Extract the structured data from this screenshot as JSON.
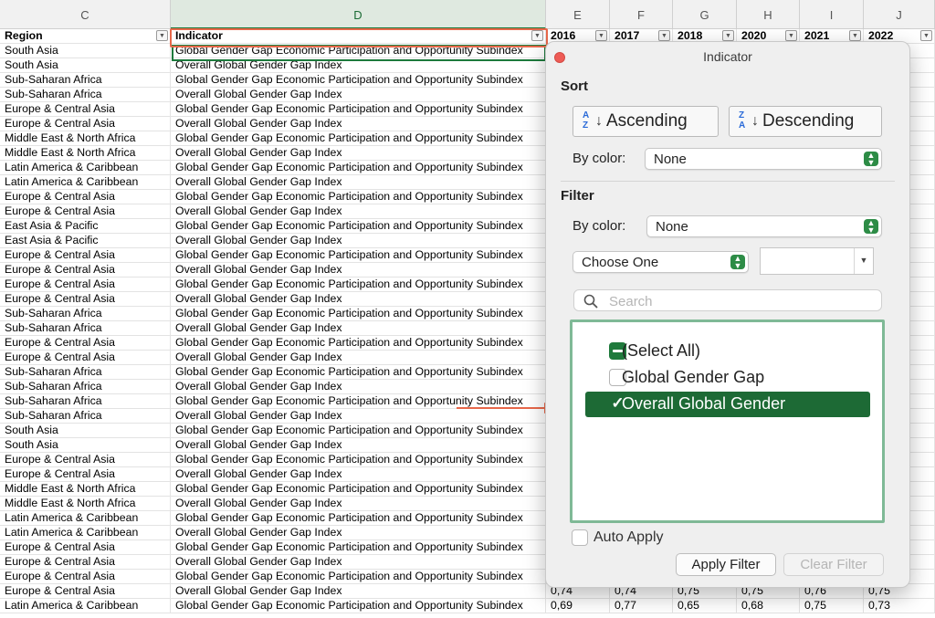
{
  "columns": [
    {
      "letter": "C",
      "header": "Region"
    },
    {
      "letter": "D",
      "header": "Indicator"
    },
    {
      "letter": "E",
      "header": "2016"
    },
    {
      "letter": "F",
      "header": "2017"
    },
    {
      "letter": "G",
      "header": "2018"
    },
    {
      "letter": "H",
      "header": "2020"
    },
    {
      "letter": "I",
      "header": "2021"
    },
    {
      "letter": "J",
      "header": "2022"
    }
  ],
  "rows": [
    [
      "South Asia",
      "Global Gender Gap Economic Participation and Opportunity Subindex"
    ],
    [
      "South Asia",
      "Overall Global Gender Gap Index"
    ],
    [
      "Sub-Saharan Africa",
      "Global Gender Gap Economic Participation and Opportunity Subindex"
    ],
    [
      "Sub-Saharan Africa",
      "Overall Global Gender Gap Index"
    ],
    [
      "Europe & Central Asia",
      "Global Gender Gap Economic Participation and Opportunity Subindex"
    ],
    [
      "Europe & Central Asia",
      "Overall Global Gender Gap Index"
    ],
    [
      "Middle East & North Africa",
      "Global Gender Gap Economic Participation and Opportunity Subindex"
    ],
    [
      "Middle East & North Africa",
      "Overall Global Gender Gap Index"
    ],
    [
      "Latin America & Caribbean",
      "Global Gender Gap Economic Participation and Opportunity Subindex"
    ],
    [
      "Latin America & Caribbean",
      "Overall Global Gender Gap Index"
    ],
    [
      "Europe & Central Asia",
      "Global Gender Gap Economic Participation and Opportunity Subindex"
    ],
    [
      "Europe & Central Asia",
      "Overall Global Gender Gap Index"
    ],
    [
      "East Asia & Pacific",
      "Global Gender Gap Economic Participation and Opportunity Subindex"
    ],
    [
      "East Asia & Pacific",
      "Overall Global Gender Gap Index"
    ],
    [
      "Europe & Central Asia",
      "Global Gender Gap Economic Participation and Opportunity Subindex"
    ],
    [
      "Europe & Central Asia",
      "Overall Global Gender Gap Index"
    ],
    [
      "Europe & Central Asia",
      "Global Gender Gap Economic Participation and Opportunity Subindex"
    ],
    [
      "Europe & Central Asia",
      "Overall Global Gender Gap Index"
    ],
    [
      "Sub-Saharan Africa",
      "Global Gender Gap Economic Participation and Opportunity Subindex"
    ],
    [
      "Sub-Saharan Africa",
      "Overall Global Gender Gap Index"
    ],
    [
      "Europe & Central Asia",
      "Global Gender Gap Economic Participation and Opportunity Subindex"
    ],
    [
      "Europe & Central Asia",
      "Overall Global Gender Gap Index"
    ],
    [
      "Sub-Saharan Africa",
      "Global Gender Gap Economic Participation and Opportunity Subindex"
    ],
    [
      "Sub-Saharan Africa",
      "Overall Global Gender Gap Index"
    ],
    [
      "Sub-Saharan Africa",
      "Global Gender Gap Economic Participation and Opportunity Subindex"
    ],
    [
      "Sub-Saharan Africa",
      "Overall Global Gender Gap Index"
    ],
    [
      "South Asia",
      "Global Gender Gap Economic Participation and Opportunity Subindex"
    ],
    [
      "South Asia",
      "Overall Global Gender Gap Index"
    ],
    [
      "Europe & Central Asia",
      "Global Gender Gap Economic Participation and Opportunity Subindex"
    ],
    [
      "Europe & Central Asia",
      "Overall Global Gender Gap Index"
    ],
    [
      "Middle East & North Africa",
      "Global Gender Gap Economic Participation and Opportunity Subindex"
    ],
    [
      "Middle East & North Africa",
      "Overall Global Gender Gap Index"
    ],
    [
      "Latin America & Caribbean",
      "Global Gender Gap Economic Participation and Opportunity Subindex"
    ],
    [
      "Latin America & Caribbean",
      "Overall Global Gender Gap Index"
    ],
    [
      "Europe & Central Asia",
      "Global Gender Gap Economic Participation and Opportunity Subindex"
    ],
    [
      "Europe & Central Asia",
      "Overall Global Gender Gap Index"
    ],
    [
      "Europe & Central Asia",
      "Global Gender Gap Economic Participation and Opportunity Subindex"
    ],
    [
      "Europe & Central Asia",
      "Overall Global Gender Gap Index",
      "0,74",
      "0,74",
      "0,75",
      "0,75",
      "0,76",
      "0,75"
    ],
    [
      "Latin America & Caribbean",
      "Global Gender Gap Economic Participation and Opportunity Subindex",
      "0,69",
      "0,77",
      "0,65",
      "0,68",
      "0,75",
      "0,73"
    ]
  ],
  "panel": {
    "title": "Indicator",
    "sort_heading": "Sort",
    "ascending_label": "Ascending",
    "descending_label": "Descending",
    "sort_by_color_label": "By color:",
    "sort_by_color_value": "None",
    "filter_heading": "Filter",
    "filter_by_color_label": "By color:",
    "filter_by_color_value": "None",
    "condition_value": "Choose One",
    "search_placeholder": "Search",
    "items": [
      {
        "label": "(Select All)",
        "state": "mixed"
      },
      {
        "label": "Global Gender Gap",
        "state": "unchecked"
      },
      {
        "label": "Overall Global Gender",
        "state": "checked"
      }
    ],
    "auto_apply_label": "Auto Apply",
    "apply_button": "Apply Filter",
    "clear_button": "Clear Filter"
  },
  "colors": {
    "accent": "#1d7a3c",
    "highlight": "#e8684a"
  }
}
